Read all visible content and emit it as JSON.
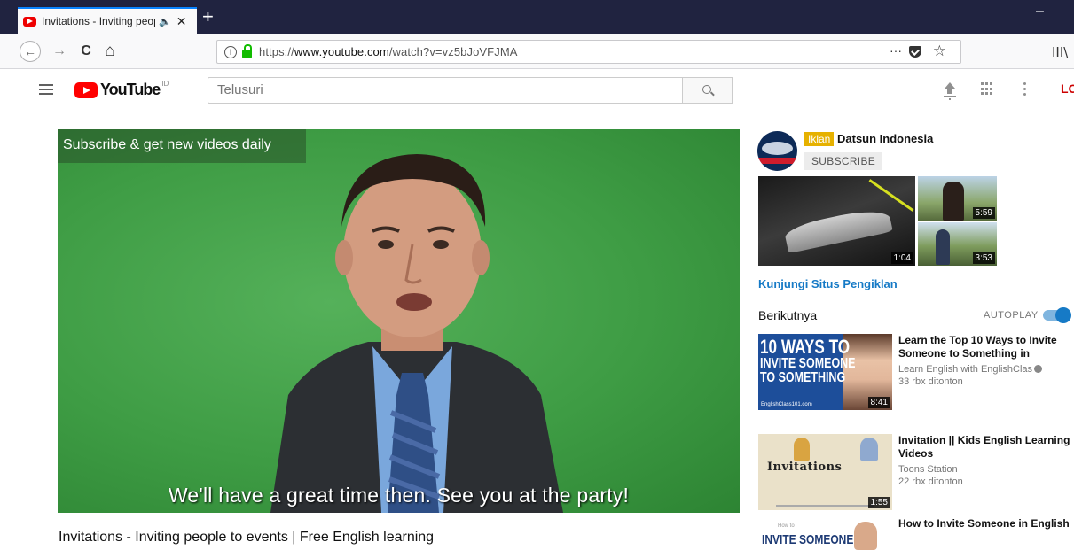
{
  "browser": {
    "tab_title": "Invitations - Inviting people",
    "speaker_icon": "speaker-icon",
    "close_glyph": "✕",
    "newtab_glyph": "+",
    "minimize_glyph": "–",
    "url_host_prefix": "https://",
    "url_host": "www.youtube.com",
    "url_path": "/watch?v=vz5bJoVFJMA",
    "more_glyph": "···",
    "back_glyph": "←",
    "forward_glyph": "→",
    "reload_glyph": "C",
    "home_glyph": "⌂",
    "star_glyph": "☆",
    "library_glyph": "III\\",
    "info_glyph": "i"
  },
  "youtube": {
    "logo_word": "YouTube",
    "region": "ID",
    "search_placeholder": "Telusuri",
    "login_label": "LO"
  },
  "player": {
    "overlay_text": "Subscribe & get new videos daily",
    "caption": "We'll have a great time then. See you at the party!"
  },
  "video": {
    "title": "Invitations - Inviting people to events | Free English learning"
  },
  "ad": {
    "label": "Iklan",
    "channel": "Datsun Indonesia",
    "subscribe": "SUBSCRIBE",
    "durations": [
      "1:04",
      "5:59",
      "3:53"
    ],
    "visit_link": "Kunjungi Situs Pengiklan"
  },
  "upnext": {
    "heading": "Berikutnya",
    "autoplay": "AUTOPLAY",
    "autoplay_on": true
  },
  "recommendations": [
    {
      "title": "Learn the Top 10 Ways to Invite Someone to Something in",
      "channel": "Learn English with EnglishClas",
      "views": "33 rbx ditonton",
      "duration": "8:41",
      "thumb_line1": "10 WAYS TO",
      "thumb_line2": "INVITE SOMEONE",
      "thumb_line3": "TO SOMETHING",
      "thumb_footer": "EnglishClass101.com"
    },
    {
      "title": "Invitation || Kids English Learning Videos",
      "channel": "Toons Station",
      "views": "22 rbx ditonton",
      "duration": "1:55",
      "thumb_word": "Invitations"
    },
    {
      "title": "How to Invite Someone in English",
      "thumb_small": "How to",
      "thumb_big": "INVITE SOMEONE"
    }
  ]
}
